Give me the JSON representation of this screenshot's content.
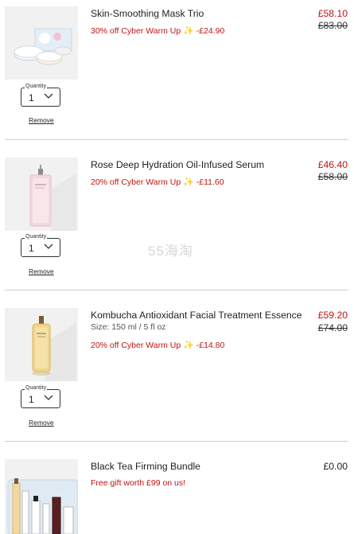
{
  "items": [
    {
      "name": "Skin-Smoothing Mask Trio",
      "promo": "30% off Cyber Warm Up",
      "promo_icon": "sparkles-icon",
      "discount": "-£24.90",
      "price": "£58.10",
      "original_price": "£83.00",
      "quantity_label": "Quantity",
      "quantity": "1",
      "remove_label": "Remove"
    },
    {
      "name": "Rose Deep Hydration Oil-Infused Serum",
      "promo": "20% off Cyber Warm Up",
      "promo_icon": "sparkles-icon",
      "discount": "-£11.60",
      "price": "£46.40",
      "original_price": "£58.00",
      "quantity_label": "Quantity",
      "quantity": "1",
      "remove_label": "Remove"
    },
    {
      "name": "Kombucha Antioxidant Facial Treatment Essence",
      "size": "Size: 150 ml / 5 fl oz",
      "promo": "20% off Cyber Warm Up",
      "promo_icon": "sparkles-icon",
      "discount": "-£14.80",
      "price": "£59.20",
      "original_price": "£74.00",
      "quantity_label": "Quantity",
      "quantity": "1",
      "remove_label": "Remove"
    },
    {
      "name": "Black Tea Firming Bundle",
      "gift_text": "Free gift worth £99 on us!",
      "price": "£0.00"
    }
  ],
  "watermark": "55海淘",
  "colors": {
    "promo": "#c21212",
    "divider": "#cfcfcf",
    "thumb_bg": "#f1f1f1"
  }
}
